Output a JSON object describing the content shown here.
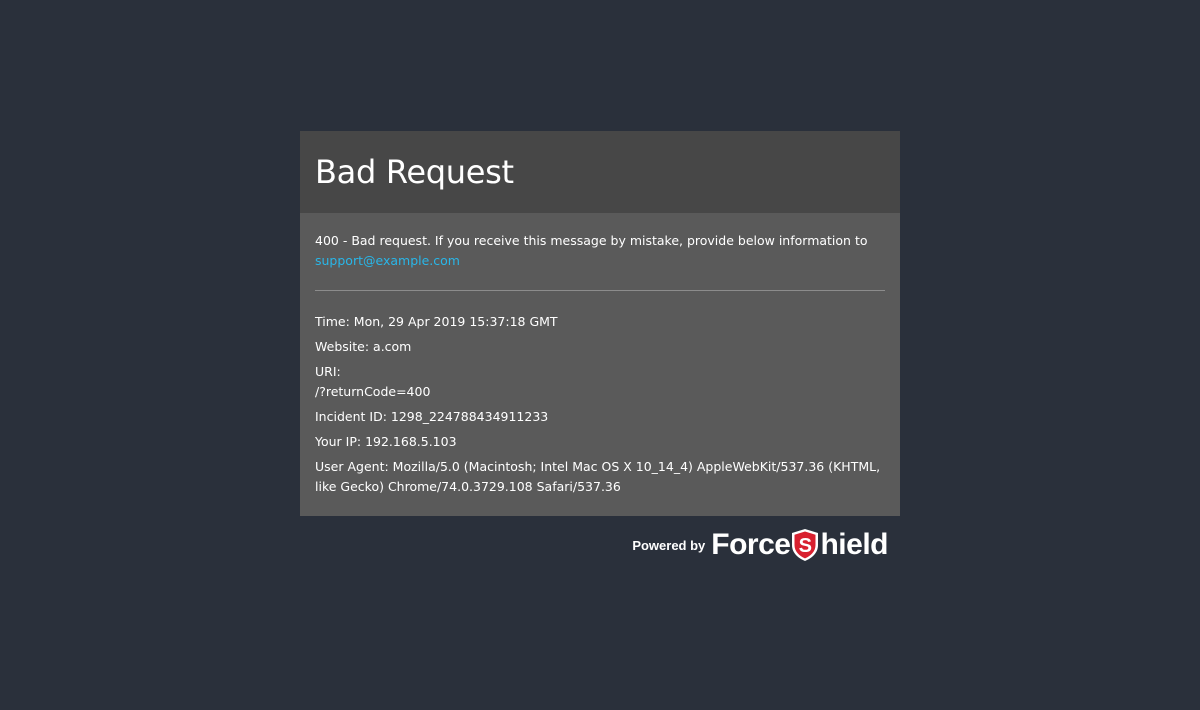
{
  "page": {
    "title": "Bad Request",
    "message": "400 - Bad request. If you receive this message by mistake, provide below information to",
    "support_email": "support@example.com",
    "info": [
      {
        "label": "Time",
        "value": "Mon, 29 Apr 2019 15:37:18 GMT"
      },
      {
        "label": "Website",
        "value": "a.com"
      },
      {
        "label": "URI",
        "value": "/?returnCode=400"
      },
      {
        "label": "Incident ID",
        "value": "1298_224788434911233"
      },
      {
        "label": "Your IP",
        "value": "192.168.5.103"
      },
      {
        "label": "User Agent",
        "value": "Mozilla/5.0 (Macintosh; Intel Mac OS X 10_14_4) AppleWebKit/537.36 (KHTML, like Gecko) Chrome/74.0.3729.108 Safari/537.36"
      }
    ]
  },
  "footer": {
    "powered_by": "Powered by",
    "brand": "ForceShield",
    "brand_part1": "Force",
    "brand_part2": "hield",
    "shield_letter": "S"
  },
  "colors": {
    "background": "#2a303b",
    "header": "#474747",
    "body": "#5a5a5a",
    "link": "#29b6e8",
    "brand_red": "#d8202f"
  },
  "icons": {
    "logo_shield": "shield-s-icon"
  }
}
